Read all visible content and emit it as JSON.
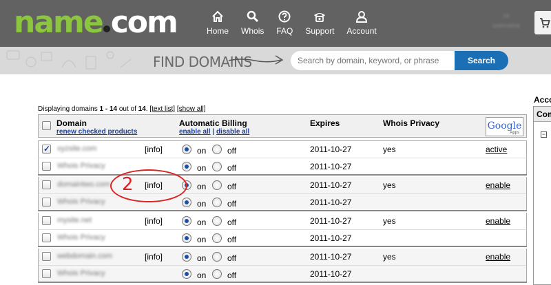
{
  "header": {
    "logo_main": "name",
    "logo_tld": "com",
    "nav": [
      {
        "label": "Home",
        "icon": "home-icon"
      },
      {
        "label": "Whois",
        "icon": "search-icon"
      },
      {
        "label": "FAQ",
        "icon": "question-icon"
      },
      {
        "label": "Support",
        "icon": "phone-icon"
      },
      {
        "label": "Account",
        "icon": "user-icon"
      }
    ],
    "user_blurred_1": "Hi",
    "user_blurred_2": "username",
    "cart_icon": "cart-icon"
  },
  "findbar": {
    "label": "FIND DOMAINS",
    "search_placeholder": "Search by domain, keyword, or phrase",
    "search_button": "Search"
  },
  "sidebar": {
    "heading": "Account",
    "box_title": "Com"
  },
  "listing": {
    "display_prefix": "Displaying domains ",
    "range": "1 - 14",
    "out_of_text": " out of ",
    "total": "14",
    "period": ". ",
    "text_list_link": "[text list]",
    "show_all_link": "[show all]"
  },
  "table": {
    "col_domain": "Domain",
    "renew_link": "renew checked products",
    "col_billing": "Automatic Billing",
    "enable_all": "enable all",
    "separator": " | ",
    "disable_all": "disable all",
    "col_expires": "Expires",
    "col_privacy": "Whois Privacy",
    "google_logo": "Google",
    "google_apps": "Apps",
    "on_label": "on",
    "off_label": "off",
    "info_label": "[info]",
    "groups": [
      {
        "domain": "xyzsite.com",
        "checked": true,
        "expires": "2011-10-27",
        "privacy": "yes",
        "google_action": "active",
        "sub": {
          "name": "Whois Privacy",
          "expires": "2011-10-27"
        }
      },
      {
        "domain": "domaintwo.com",
        "checked": false,
        "expires": "2011-10-27",
        "privacy": "yes",
        "google_action": "enable",
        "sub": {
          "name": "Whois Privacy",
          "expires": "2011-10-27"
        }
      },
      {
        "domain": "mysite.net",
        "checked": false,
        "expires": "2011-10-27",
        "privacy": "yes",
        "google_action": "enable",
        "sub": {
          "name": "Whois Privacy",
          "expires": "2011-10-27"
        }
      },
      {
        "domain": "webdomain.com",
        "checked": false,
        "expires": "2011-10-27",
        "privacy": "yes",
        "google_action": "enable",
        "sub": {
          "name": "Whois Privacy",
          "expires": "2011-10-27"
        }
      }
    ]
  },
  "annotation": {
    "number": "2",
    "color": "#dd2222"
  },
  "colors": {
    "header_bg": "#626262",
    "logo_green": "#8cc63e",
    "search_blue": "#1a6fb5",
    "link_blue": "#1a3fa0"
  }
}
